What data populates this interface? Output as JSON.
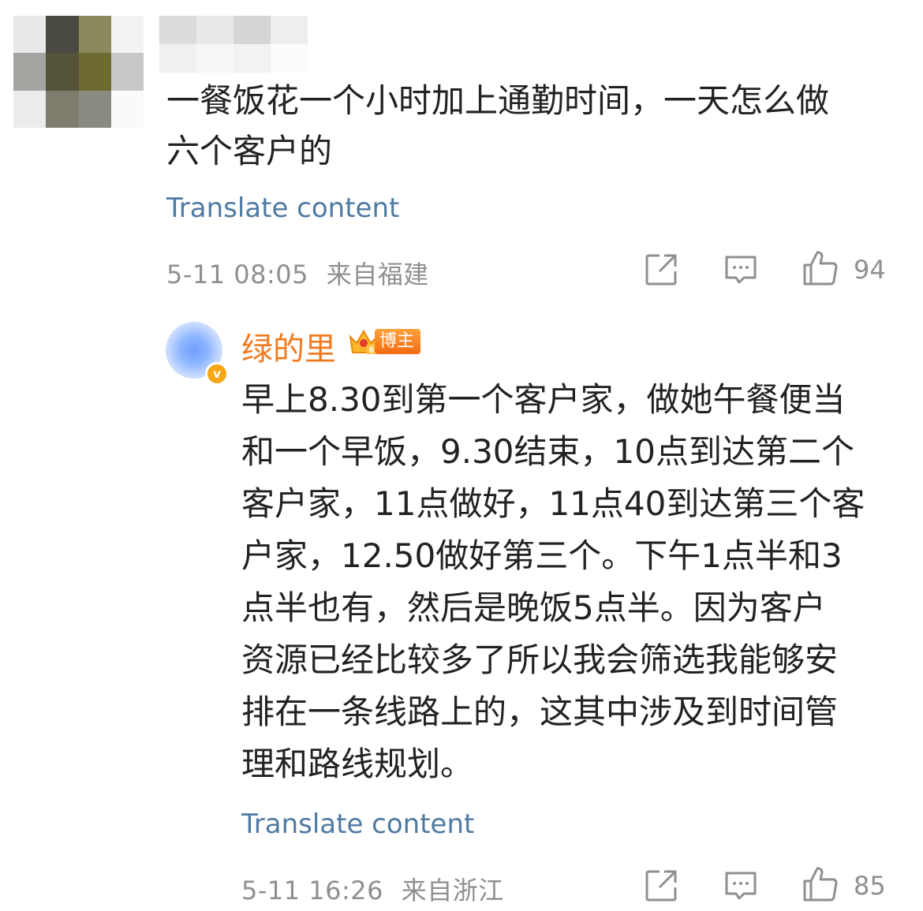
{
  "comment": {
    "avatar_colors": [
      "#e9e9e9",
      "#4a4a42",
      "#8b8a5c",
      "#f3f3f3",
      "#a4a4a0",
      "#55543a",
      "#6e6b30",
      "#c8c8c8",
      "#ececec",
      "#7e7c6c",
      "#8a8a80",
      "#fafafa"
    ],
    "name_colors": [
      "#dcdcdc",
      "#e8e8e8",
      "#d6d6d6",
      "#eeeeee",
      "#f0f0f0",
      "#f6f6f6",
      "#f2f2f2",
      "#fbfbfb"
    ],
    "text_line1": "一餐饭花一个小时加上通勤时间，一天怎么做",
    "text_line2": "六个客户的",
    "translate_label": "Translate content",
    "timestamp": "5-11 08:05",
    "location": "来自福建",
    "share_icon": "share-icon",
    "reply_icon": "comment-icon",
    "like_icon": "thumbs-up-icon",
    "like_count": "94"
  },
  "reply": {
    "username": "绿的里",
    "badge_label": "博主",
    "badge_level": "6",
    "verified_mark": "v",
    "lines": [
      "早上8.30到第一个客户家，做她午餐便当",
      "和一个早饭，9.30结束，10点到达第二个",
      "客户家，11点做好，11点40到达第三个客",
      "户家，12.50做好第三个。下午1点半和3",
      "点半也有，然后是晚饭5点半。因为客户",
      "资源已经比较多了所以我会筛选我能够安",
      "排在一条线路上的，这其中涉及到时间管",
      "理和路线规划。"
    ],
    "translate_label": "Translate content",
    "timestamp": "5-11 16:26",
    "location": "来自浙江",
    "like_count": "85"
  }
}
